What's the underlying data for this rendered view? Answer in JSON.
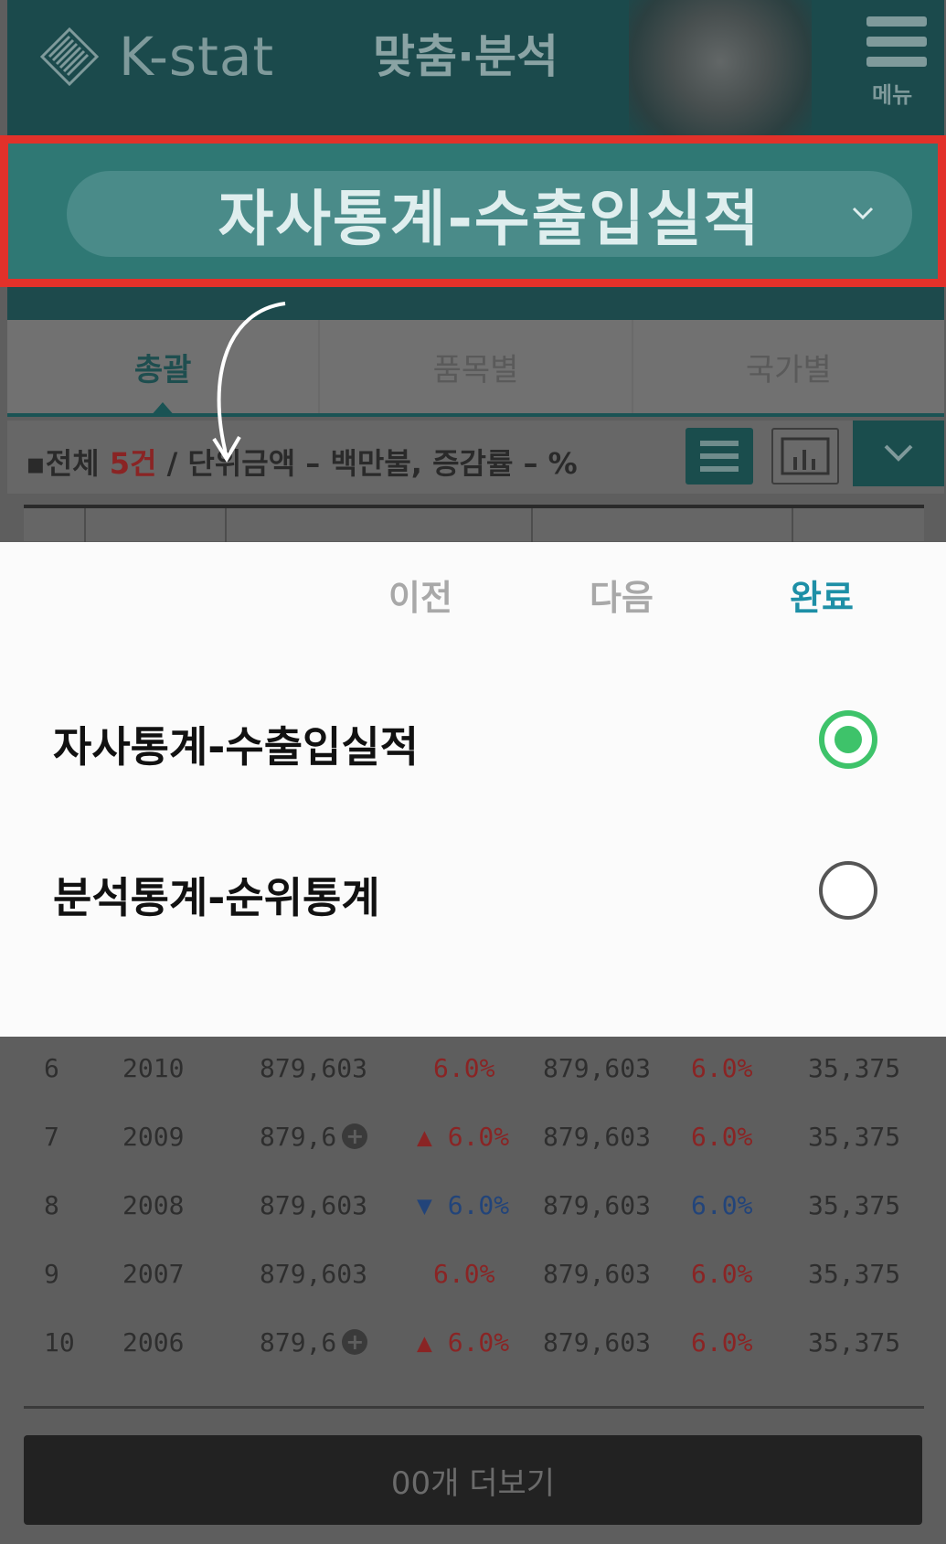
{
  "header": {
    "logo_text": "K-stat",
    "title": "맞춤·분석",
    "menu_label": "메뉴"
  },
  "selector": {
    "current": "자사통계-수출입실적"
  },
  "tabs": [
    {
      "label": "총괄",
      "active": true
    },
    {
      "label": "품목별",
      "active": false
    },
    {
      "label": "국가별",
      "active": false
    }
  ],
  "summary": {
    "prefix": "전체 ",
    "count": "5건",
    "suffix": " / 단위금액 – 백만불, 증감률 – %"
  },
  "table": {
    "rows": [
      {
        "rank": "6",
        "year": "2010",
        "export": "879,603",
        "export_rate": "6.0%",
        "export_dir": "",
        "import": "879,603",
        "import_rate": "6.0%",
        "import_color": "red",
        "balance": "35,375",
        "export_expand": false
      },
      {
        "rank": "7",
        "year": "2009",
        "export": "879,6",
        "export_rate": "6.0%",
        "export_dir": "up",
        "import": "879,603",
        "import_rate": "6.0%",
        "import_color": "red",
        "balance": "35,375",
        "export_expand": true
      },
      {
        "rank": "8",
        "year": "2008",
        "export": "879,603",
        "export_rate": "6.0%",
        "export_dir": "down",
        "import": "879,603",
        "import_rate": "6.0%",
        "import_color": "blue",
        "balance": "35,375",
        "export_expand": false
      },
      {
        "rank": "9",
        "year": "2007",
        "export": "879,603",
        "export_rate": "6.0%",
        "export_dir": "",
        "import": "879,603",
        "import_rate": "6.0%",
        "import_color": "red",
        "balance": "35,375",
        "export_expand": false
      },
      {
        "rank": "10",
        "year": "2006",
        "export": "879,6",
        "export_rate": "6.0%",
        "export_dir": "up",
        "import": "879,603",
        "import_rate": "6.0%",
        "import_color": "red",
        "balance": "35,375",
        "export_expand": true
      }
    ],
    "more_button": "00개 더보기"
  },
  "sheet": {
    "prev_label": "이전",
    "next_label": "다음",
    "done_label": "완료",
    "options": [
      {
        "label": "자사통계-수출입실적",
        "selected": true
      },
      {
        "label": "분석통계-순위통계",
        "selected": false
      }
    ]
  },
  "colors": {
    "brand_teal": "#1b4a4c",
    "highlight_red": "#e2312a",
    "radio_green": "#3ec36a",
    "done_blue": "#1d8fa6"
  }
}
